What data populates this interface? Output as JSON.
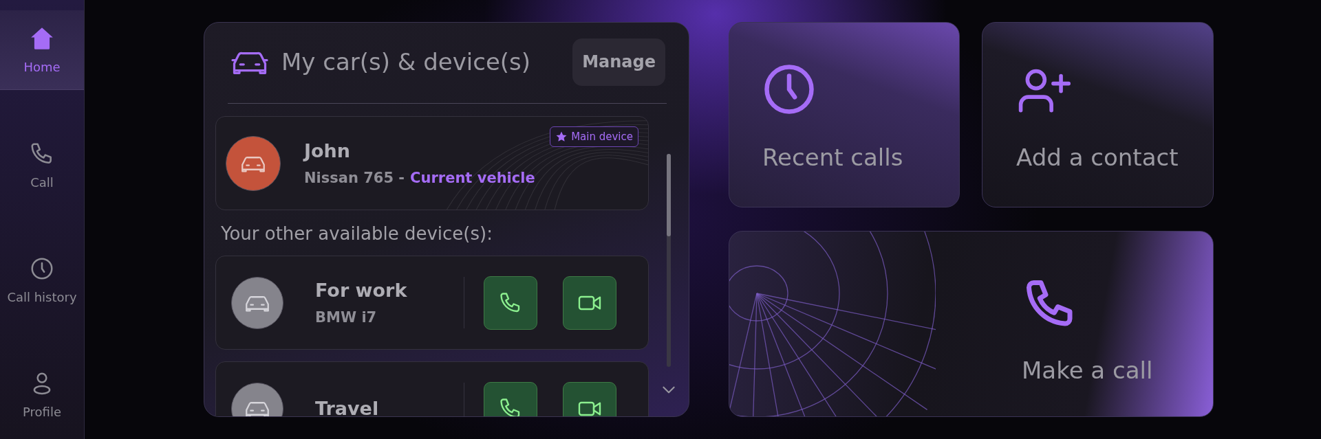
{
  "sidebar": {
    "items": [
      {
        "label": "Home",
        "selected": true
      },
      {
        "label": "Call",
        "selected": false
      },
      {
        "label": "Call history",
        "selected": false
      },
      {
        "label": "Profile",
        "selected": false
      }
    ]
  },
  "devices_panel": {
    "title": "My car(s) & device(s)",
    "manage_button": "Manage",
    "main_device": {
      "name": "John",
      "model": "Nissan 765 -",
      "status": "Current vehicle",
      "badge": "Main device",
      "color": "#c4533b"
    },
    "other_heading": "Your other available device(s):",
    "other_devices": [
      {
        "name": "For work",
        "model": "BMW i7",
        "color": "#85848c"
      },
      {
        "name": "Travel",
        "color": "#85848c"
      }
    ]
  },
  "quick_actions": [
    {
      "label": "Recent calls"
    },
    {
      "label": "Add a contact"
    },
    {
      "label": "Make a call"
    }
  ]
}
